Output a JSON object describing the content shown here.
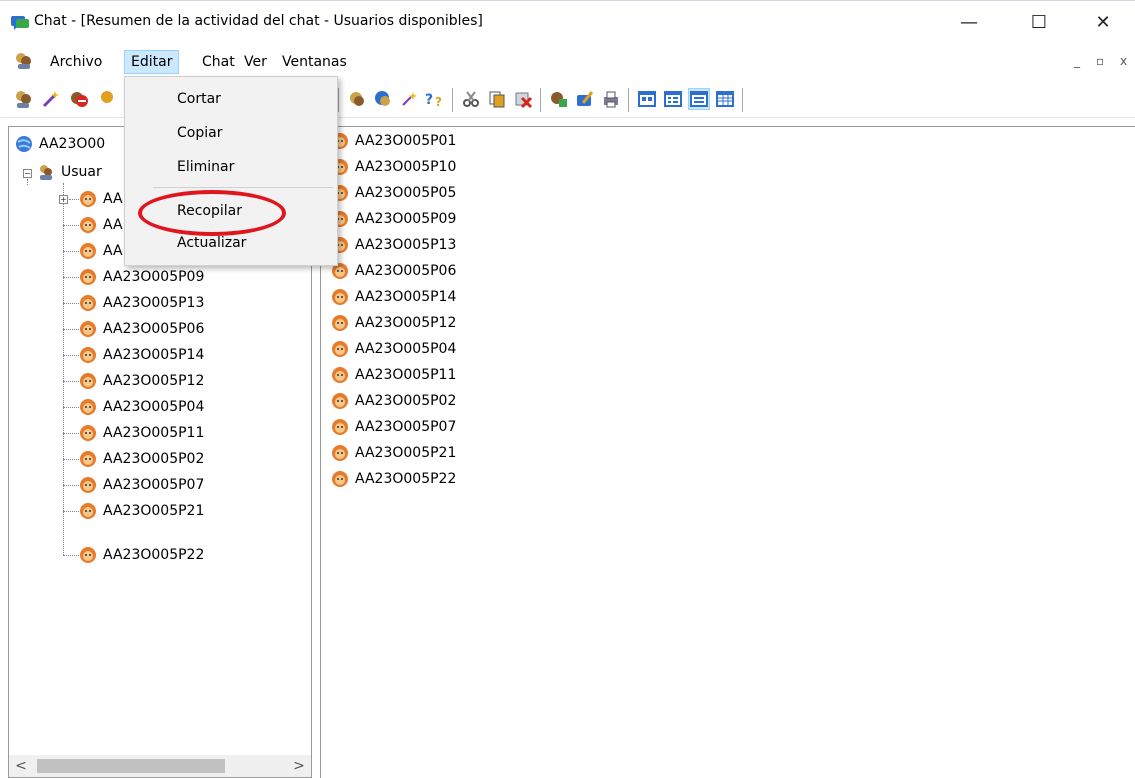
{
  "window": {
    "title": "Chat - [Resumen de la actividad del chat - Usuarios disponibles]",
    "minimize_glyph": "—",
    "maximize_glyph": "☐",
    "close_glyph": "✕"
  },
  "menubar": {
    "items": [
      {
        "label": "Archivo"
      },
      {
        "label": "Editar"
      },
      {
        "label": "Chat"
      },
      {
        "label": "Ver"
      },
      {
        "label": "Ventanas"
      }
    ],
    "mdi_minimize": "_",
    "mdi_restore": "▫",
    "mdi_close": "x"
  },
  "edit_menu": {
    "items": [
      {
        "label": "Cortar"
      },
      {
        "label": "Copiar"
      },
      {
        "label": "Eliminar"
      },
      {
        "label": "Recopilar"
      },
      {
        "label": "Actualizar"
      }
    ],
    "highlight_color": "#e0161e"
  },
  "tree": {
    "root": "AA23O00",
    "group": "Usuar",
    "collapsed_children": [
      "AA",
      "AA",
      "AA"
    ],
    "children": [
      "AA23O005P09",
      "AA23O005P13",
      "AA23O005P06",
      "AA23O005P14",
      "AA23O005P12",
      "AA23O005P04",
      "AA23O005P11",
      "AA23O005P02",
      "AA23O005P07",
      "AA23O005P21",
      "AA23O005P22"
    ]
  },
  "user_list": [
    "AA23O005P01",
    "AA23O005P10",
    "AA23O005P05",
    "AA23O005P09",
    "AA23O005P13",
    "AA23O005P06",
    "AA23O005P14",
    "AA23O005P12",
    "AA23O005P04",
    "AA23O005P11",
    "AA23O005P02",
    "AA23O005P07",
    "AA23O005P21",
    "AA23O005P22"
  ],
  "scrollbar": {
    "left_arrow": "<",
    "right_arrow": ">"
  }
}
